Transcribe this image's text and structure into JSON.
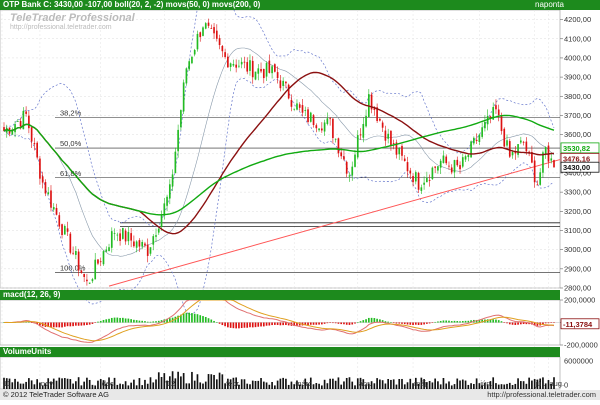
{
  "header": {
    "main": "OTP Bank C: 3430,00 -107,00 boll(20, 2, -2) movs(50, 0) movs(200, 0)",
    "period": "napontа",
    "macd": "macd(12, 26, 9)",
    "volume": "VolumeUnits"
  },
  "watermark": {
    "title": "TeleTrader Professional",
    "url": "http://professional.teletrader.com"
  },
  "footer": {
    "copyright": "© 2012 TeleTrader Software AG",
    "url": "http://professional.teletrader.com"
  },
  "colors": {
    "header_bg": "#1d8a1d",
    "up": "#22bb22",
    "down": "#dd1111",
    "ma50": "#8b1010",
    "ma200": "#11aa11",
    "boll": "#6677cc",
    "trend": "#ff5555",
    "macd_line": "#e07070",
    "signal_line": "#e0a020"
  },
  "chart_data": {
    "type": "candlestick",
    "title": "OTP Bank C: 3430,00 -107,00",
    "ylim": [
      2800,
      4250
    ],
    "y_ticks": [
      "4200,00",
      "4100,00",
      "4000,00",
      "3900,00",
      "3800,00",
      "3700,00",
      "3600,00",
      "3500,00",
      "3400,00",
      "3300,00",
      "3200,00",
      "3100,00",
      "3000,00",
      "2900,00",
      "2800,00"
    ],
    "x_labels": [
      "11",
      "nov.",
      "dec.",
      "'12",
      "febr.",
      "márc.",
      "ápr.",
      "máj.",
      "jún.",
      "júl.",
      "aug."
    ],
    "fib_levels": [
      {
        "label": "38,2%",
        "value": 3690
      },
      {
        "label": "50,0%",
        "value": 3530
      },
      {
        "label": "61,8%",
        "value": 3375
      },
      {
        "label": "100,0%",
        "value": 2880
      }
    ],
    "price_tags": [
      {
        "label": "3530,82",
        "value": 3530.82,
        "color": "#11aa11"
      },
      {
        "label": "3476,16",
        "value": 3476.16,
        "color": "#8b1010"
      },
      {
        "label": "3430,00",
        "value": 3430,
        "color": "#111111"
      }
    ],
    "series": [
      {
        "name": "boll(20, 2, -2)"
      },
      {
        "name": "movs(50, 0)"
      },
      {
        "name": "movs(200, 0)"
      }
    ],
    "macd": {
      "label": "macd(12, 26, 9)",
      "value_tag": "-11,3784",
      "y_ticks": [
        "200,0000",
        "0,0000",
        "-200,0000"
      ]
    },
    "volume": {
      "label": "VolumeUnits",
      "y_ticks": [
        "6000000",
        "0"
      ]
    }
  }
}
